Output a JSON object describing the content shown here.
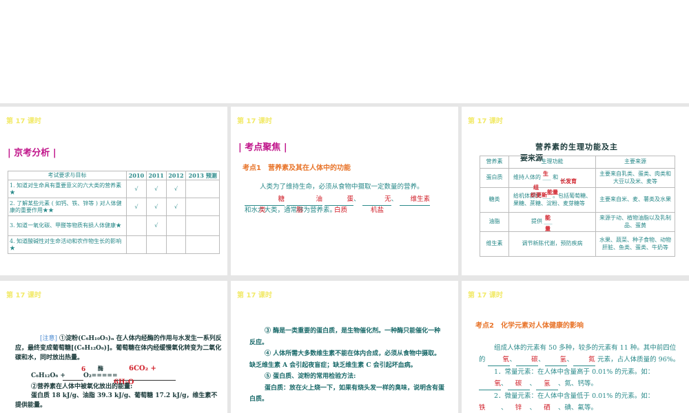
{
  "lesson": "第 17 课时",
  "slide1": {
    "section": "京考分析",
    "headers": [
      "考试要求与目标",
      "2010",
      "2011",
      "2012",
      "2013 预测"
    ],
    "rows": [
      {
        "text": "1. 知道对生命具有重要意义的六大类的营养素★",
        "marks": [
          "√",
          "√",
          "√",
          ""
        ]
      },
      {
        "text": "2. 了解某些元素 ( 如钙、铁、锌等 ) 对人体健康的重要作用★★",
        "marks": [
          "√",
          "√",
          "√",
          ""
        ]
      },
      {
        "text": "3. 知道一氧化碳、甲醛等物质有损人体健康★",
        "marks": [
          "",
          "√",
          "",
          ""
        ]
      },
      {
        "text": "4. 知道酸碱性对生命活动和农作物生长的影响★",
        "marks": [
          "",
          "",
          "",
          ""
        ]
      }
    ]
  },
  "slide2": {
    "section": "考点聚焦",
    "topic": "考点1　营养素及其在人体中的功能",
    "para": "人类为了维持生命，必须从食物中摄取一定数量的营养。",
    "blanks": [
      "糖",
      "油",
      "蛋",
      "无",
      "维生素"
    ],
    "sep": "、",
    "line2": "和水六大类，通常称为营养素。",
    "red2": [
      "类",
      "脂",
      "白质",
      "机盐"
    ]
  },
  "slide3": {
    "title": "营养素的生理功能及主",
    "title2": "要来源",
    "headers": [
      "营养素",
      "生理功能",
      "主要来源"
    ],
    "rows": [
      {
        "name": "蛋白质",
        "func": "维持人体的 ___ 和 ___",
        "fills": [
          "生",
          "长发育",
          "组",
          "织更新"
        ],
        "src": "主要来自乳类、蛋类、肉类和大豆以及米、麦等"
      },
      {
        "name": "糖类",
        "func": "给机体提供 ___ 。包括葡萄糖、果糖、蔗糖、淀粉、麦芽糖等",
        "fills": [
          "能量"
        ],
        "src": "主要来自米、麦、薯类及水果"
      },
      {
        "name": "油脂",
        "func": "提供 ___",
        "fills": [
          "能",
          "量"
        ],
        "src": "来源于动、植物油脂以及乳制品、蛋黄"
      },
      {
        "name": "维生素",
        "func": "调节新陈代谢，预防疾病",
        "fills": [],
        "src": "水果、蔬菜、种子食物、动物肝脏、鱼类、蛋类、牛奶等"
      }
    ]
  },
  "slide4": {
    "note": "[注意]",
    "p1": "①淀粉(C₆H₁₀O₅)ₙ 在人体内经酶的作用与水发生一系列反应，最终变成葡萄糖[(C₆H₁₂O₆)]。葡萄糖在体内经缓慢氧化转变为二氧化碳和水，同时放出热量。",
    "eq_left": "C₆H₁₂O₆ +",
    "eq_coef": "6",
    "eq_o2": "O₂=====",
    "eq_cat": "酶",
    "eq_right1": "6CO₂ +",
    "eq_right2": "6H₂O",
    "p2": "②营养素在人体中被氧化放出的能量:",
    "p3": "蛋白质 18 kJ/g、油脂 39.3 kJ/g、葡萄糖 17.2 kJ/g，维生素不提供能量。"
  },
  "slide5": {
    "paras": [
      "③ 酶是一类重要的蛋白质，是生物催化剂。一种酶只能催化一种反应。",
      "④ 人体所需大多数维生素不能在体内合成，必须从食物中摄取。缺乏维生素 A 会引起夜盲症；缺乏维生素 C 会引起坏血病。",
      "⑤ 蛋白质、淀粉的常用检验方法:",
      "蛋白质：放在火上烧一下，如果有烧头发一样的臭味，说明含有蛋白质。"
    ]
  },
  "slide6": {
    "topic": "考点2　化学元素对人体健康的影响",
    "p1a": "组成人体的元素有 50 多种，较多的元素有 11 种。其中前四位的",
    "b1": [
      "氧",
      "碳",
      "氢",
      "氮"
    ],
    "p1b": "元素，占人体质量的 96%。",
    "p2": "1．常量元素：在人体中含量高于 0.01% 的元素。如：",
    "b2": [
      "氧",
      "碳",
      "氢"
    ],
    "p2b": "、氮、钙等。",
    "p3": "2．微量元素：在人体中含量低于 0.01% 的元素。如：",
    "b3": [
      "铁",
      "锌",
      "硒"
    ],
    "p3b": "、碘、氟等。"
  }
}
